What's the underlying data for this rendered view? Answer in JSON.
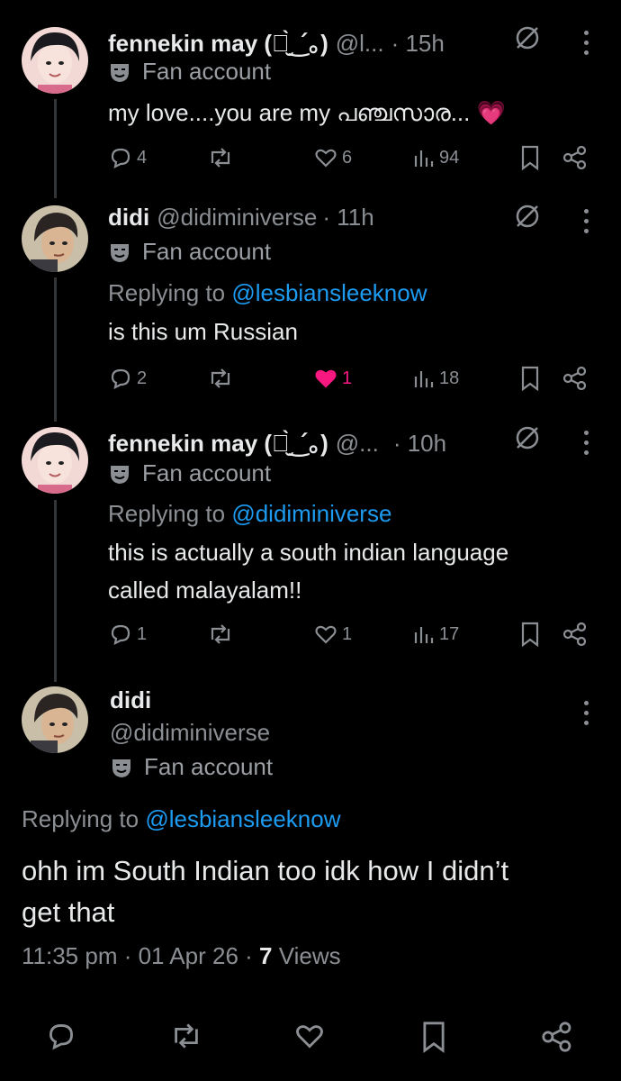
{
  "tweets": [
    {
      "name": "fennekin may (。̮̀‿́。)",
      "handle": "@l...",
      "time": "· 15h",
      "badge": "Fan account",
      "replying_prefix": "",
      "replying_handle": "",
      "text_lines": [
        "my love....you are my പഞ്ചസാര... 💗"
      ],
      "replies": "4",
      "reposts": "",
      "likes": "6",
      "views": "94",
      "liked": false
    },
    {
      "name": "didi",
      "handle": "@didiminiverse",
      "time": "· 11h",
      "badge": "Fan account",
      "replying_prefix": "Replying to ",
      "replying_handle": "@lesbiansleeknow",
      "text_lines": [
        "is this um Russian"
      ],
      "replies": "2",
      "reposts": "",
      "likes": "1",
      "views": "18",
      "liked": true
    },
    {
      "name": "fennekin may (。̮̀‿́。)",
      "handle": "@...",
      "time": "· 10h",
      "badge": "Fan account",
      "replying_prefix": "Replying to ",
      "replying_handle": "@didiminiverse",
      "text_lines": [
        "this is actually a south indian language",
        "called malayalam!!"
      ],
      "replies": "1",
      "reposts": "",
      "likes": "1",
      "views": "17",
      "liked": false
    }
  ],
  "main": {
    "name": "didi",
    "handle": "@didiminiverse",
    "badge": "Fan account",
    "replying_prefix": "Replying to ",
    "replying_handle": "@lesbiansleeknow",
    "text_lines": [
      "ohh im South Indian too idk how I didn’t",
      "get that"
    ],
    "time": "11:35 pm",
    "date": "01 Apr 26",
    "views_count": "7",
    "views_label": "Views"
  },
  "icons": {
    "reply": "speech-bubble-icon",
    "repost": "repost-arrows-icon",
    "like": "heart-icon",
    "views": "bar-chart-icon",
    "bookmark": "bookmark-icon",
    "share": "share-nodes-icon",
    "badge": "theater-mask-icon",
    "nomod": "circle-slash-icon",
    "more": "vertical-ellipsis-icon"
  },
  "colors": {
    "link": "#1d9bf0",
    "like": "#f91880",
    "muted": "#8b8f94"
  }
}
